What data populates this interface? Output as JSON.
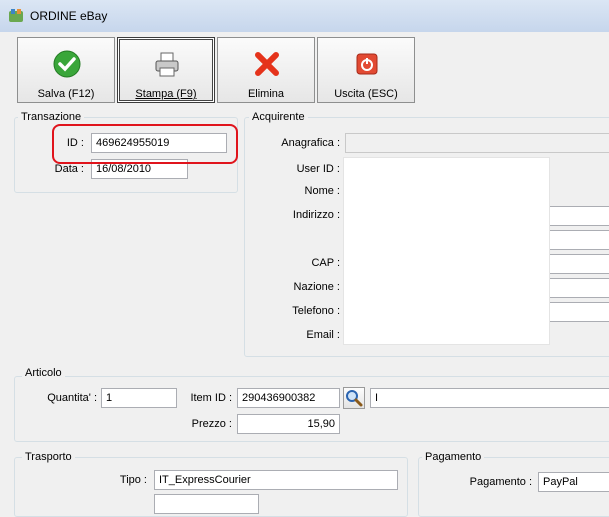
{
  "window": {
    "title": "ORDINE eBay",
    "icon": "ebay-app-icon"
  },
  "toolbar": {
    "save_label": "Salva (F12)",
    "print_label": "Stampa (F9)",
    "delete_label": "Elimina",
    "exit_label": "Uscita (ESC)"
  },
  "transazione": {
    "title": "Transazione",
    "id_label": "ID :",
    "id_value": "469624955019",
    "data_label": "Data :",
    "data_value": "16/08/2010"
  },
  "acquirente": {
    "title": "Acquirente",
    "anagrafica_label": "Anagrafica :",
    "userid_label": "User ID :",
    "nome_label": "Nome :",
    "indirizzo_label": "Indirizzo :",
    "cap_label": "CAP :",
    "nazione_label": "Nazione :",
    "telefono_label": "Telefono :",
    "email_label": "Email :"
  },
  "articolo": {
    "title": "Articolo",
    "quantita_label": "Quantita' :",
    "quantita_value": "1",
    "itemid_label": "Item ID :",
    "itemid_value": "290436900382",
    "desc_value": "I",
    "prezzo_label": "Prezzo :",
    "prezzo_value": "15,90"
  },
  "trasporto": {
    "title": "Trasporto",
    "tipo_label": "Tipo :",
    "tipo_value": "IT_ExpressCourier"
  },
  "pagamento": {
    "title": "Pagamento",
    "pagamento_label": "Pagamento :",
    "pagamento_value": "PayPal"
  },
  "colors": {
    "highlight": "#e0141c",
    "titlebar": "#c6d6ec"
  }
}
